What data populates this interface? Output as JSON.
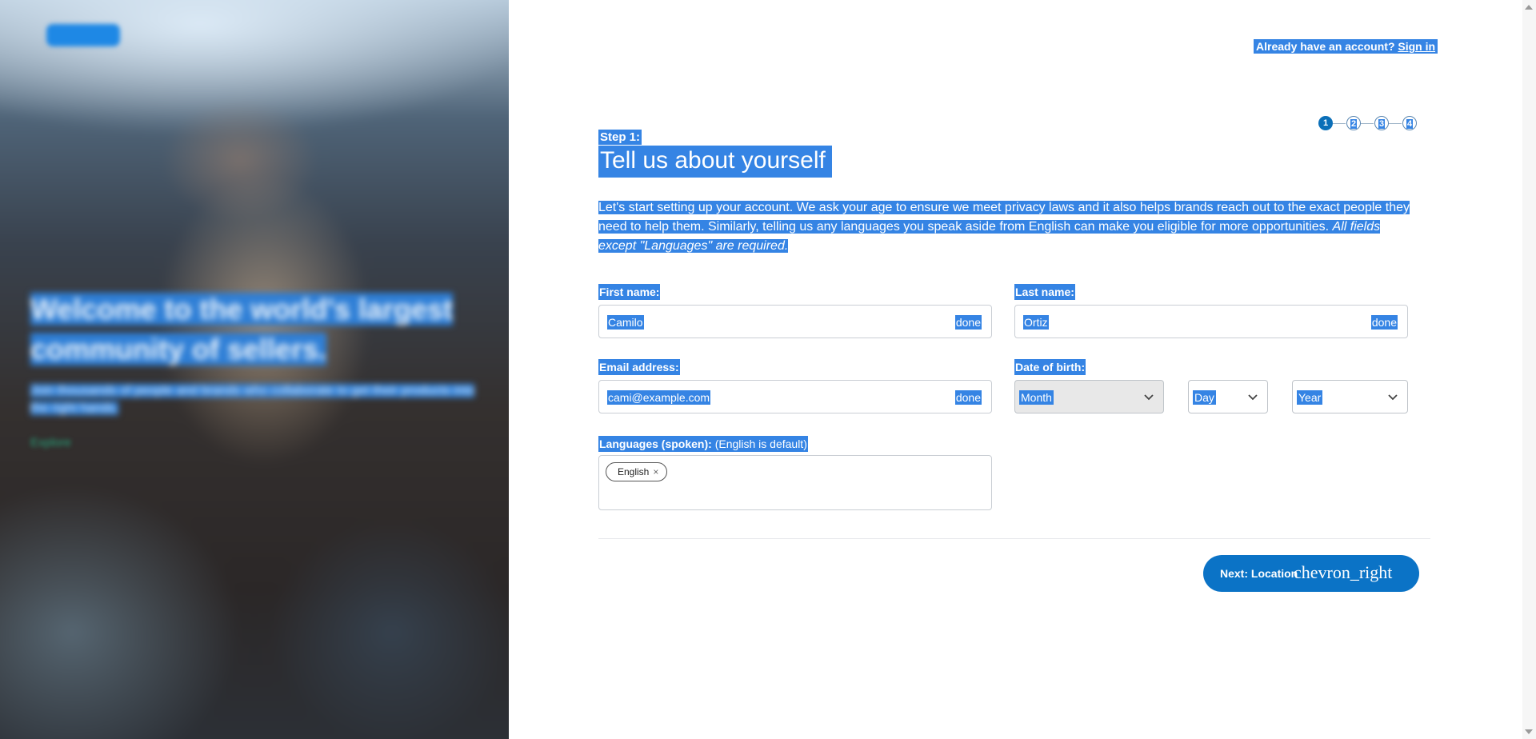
{
  "hero": {
    "title": "Welcome to the world's largest community of sellers.",
    "subtitle": "Join thousands of people and brands who collaborate to get their products into the right hands.",
    "link": "Explore"
  },
  "header": {
    "prompt": "Already have an account?",
    "signin_label": "Sign in"
  },
  "stepper": {
    "steps": [
      "1",
      "2",
      "3",
      "4"
    ],
    "current": 1
  },
  "step": {
    "label": "Step 1:",
    "title": "Tell us about yourself",
    "intro": "Let's start setting up your account. We ask your age to ensure we meet privacy laws and it also helps brands reach out to the exact people they need to help them. Similarly, telling us any languages you speak aside from English can make you eligible for more opportunities.",
    "intro_note": "All fields except \"Languages\" are required."
  },
  "form": {
    "first_name": {
      "label": "First name:",
      "value": "Camilo",
      "status": "done"
    },
    "last_name": {
      "label": "Last name:",
      "value": "Ortiz",
      "status": "done"
    },
    "email": {
      "label": "Email address:",
      "value": "cami@example.com",
      "status": "done"
    },
    "dob": {
      "label": "Date of birth:",
      "month": "Month",
      "day": "Day",
      "year": "Year"
    },
    "languages": {
      "label": "Languages (spoken):",
      "hint": "(English is default)",
      "chips": [
        "English"
      ],
      "remove_glyph": "×"
    }
  },
  "footer": {
    "next_label": "Next: Location",
    "next_icon": "chevron_right"
  },
  "colors": {
    "accent": "#0b73c6",
    "selection": "#3584e4"
  }
}
